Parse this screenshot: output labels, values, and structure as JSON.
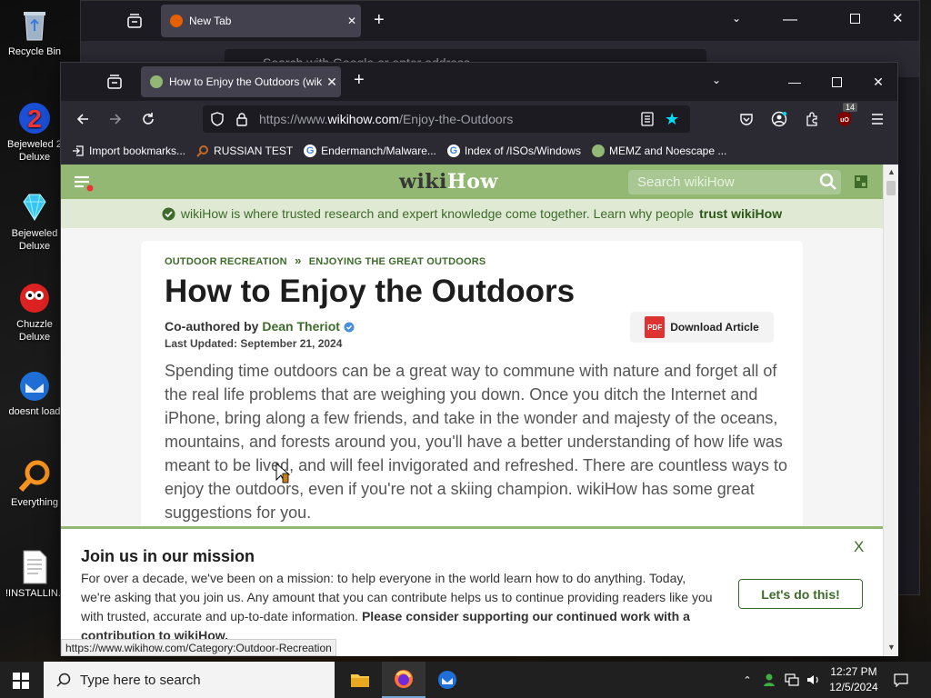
{
  "desktop": {
    "icons": [
      {
        "label": "Recycle Bin"
      },
      {
        "label": "Bejeweled 2 Deluxe"
      },
      {
        "label": "Bejeweled Deluxe"
      },
      {
        "label": "Chuzzle Deluxe"
      },
      {
        "label": "doesnt load"
      },
      {
        "label": "Everything"
      },
      {
        "label": "!INSTALLIN..."
      }
    ]
  },
  "back_window": {
    "tab_title": "New Tab",
    "url_placeholder": "Search with Google or enter address"
  },
  "browser": {
    "tab_title": "How to Enjoy the Outdoors (wik",
    "url_prefix": "https://www.",
    "url_host": "wikihow.com",
    "url_path": "/Enjoy-the-Outdoors",
    "extension_badge": "14",
    "bookmarks": [
      {
        "label": "Import bookmarks..."
      },
      {
        "label": "RUSSIAN TEST"
      },
      {
        "label": "Endermanch/Malware..."
      },
      {
        "label": "Index of /ISOs/Windows"
      },
      {
        "label": "MEMZ and Noescape ..."
      }
    ]
  },
  "page": {
    "logo_part1": "wiki",
    "logo_part2": "How",
    "search_placeholder": "Search wikiHow",
    "trust_text": "wikiHow is where trusted research and expert knowledge come together. Learn why people",
    "trust_bold": "trust wikiHow",
    "breadcrumb_1": "OUTDOOR RECREATION",
    "breadcrumb_sep": "»",
    "breadcrumb_2": "ENJOYING THE GREAT OUTDOORS",
    "title": "How to Enjoy the Outdoors",
    "coauthored_by": "Co-authored by",
    "author": "Dean Theriot",
    "last_updated": "Last Updated: September 21, 2024",
    "download_label": "Download Article",
    "pdf_label": "PDF",
    "intro": "Spending time outdoors can be a great way to commune with nature and forget all of the real life problems that are weighing you down. Once you ditch the Internet and iPhone, bring along a few friends, and take in the wonder and majesty of the oceans, mountains, and forests around you, you'll have a better understanding of how life was meant to be lived, and will feel invigorated and refreshed. There are countless ways to enjoy the outdoors, even if you're not a skiing champion. wikiHow has some great suggestions for you.",
    "banner": {
      "title": "Join us in our mission",
      "body": "For over a decade, we've been on a mission: to help everyone in the world learn how to do anything. Today, we're asking that you join us. Any amount that you can contribute helps us to continue providing readers like you with trusted, accurate and up-to-date information.",
      "body_bold": "Please consider supporting our continued work with a contribution to wikiHow.",
      "close": "X",
      "cta": "Let's do this!"
    },
    "status_url": "https://www.wikihow.com/Category:Outdoor-Recreation"
  },
  "taskbar": {
    "search_placeholder": "Type here to search",
    "time": "12:27 PM",
    "date": "12/5/2024"
  },
  "colors": {
    "wikihow_green": "#93b874",
    "wikihow_dark_green": "#3d6b2a",
    "firefox_dark": "#1c1b22",
    "firefox_toolbar": "#2b2a33"
  }
}
